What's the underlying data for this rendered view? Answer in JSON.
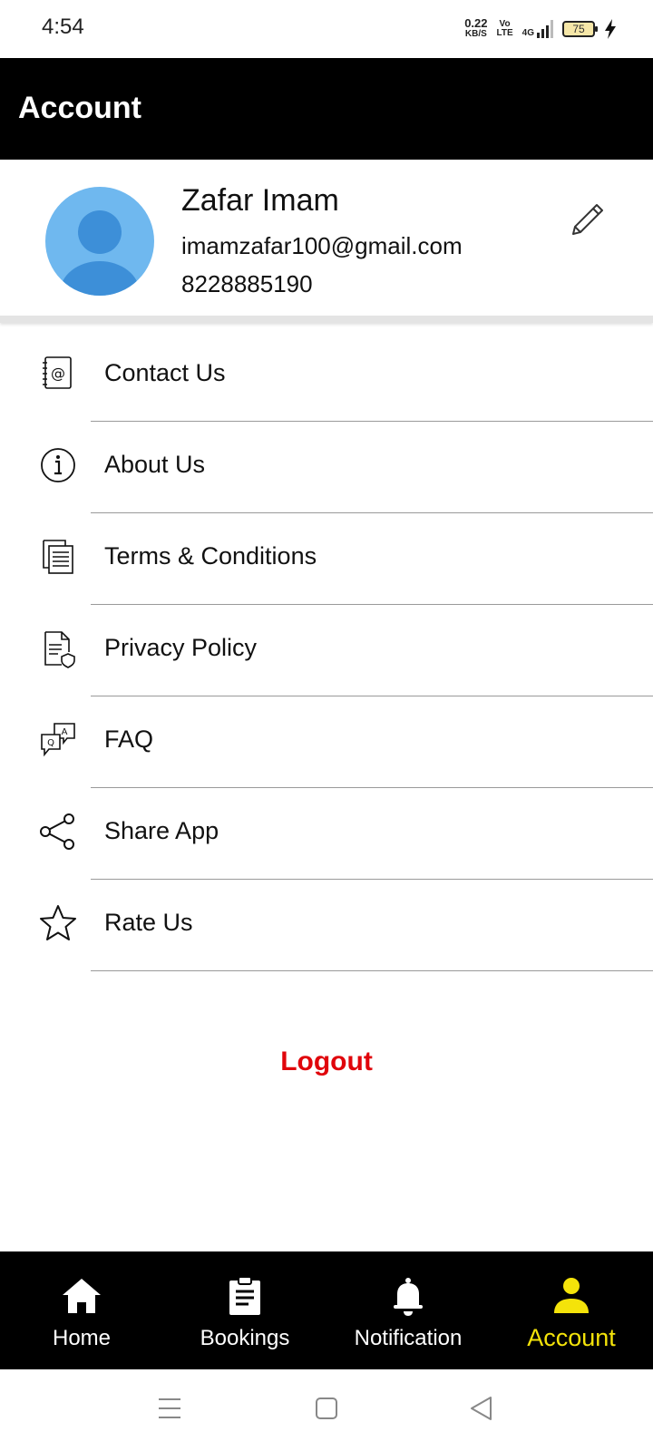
{
  "status_bar": {
    "time": "4:54",
    "net_speed": "0.22",
    "net_unit": "KB/S",
    "volte_top": "Vo",
    "volte_bottom": "LTE",
    "network": "4G",
    "battery": "75"
  },
  "header": {
    "title": "Account"
  },
  "profile": {
    "name": "Zafar Imam",
    "email": "imamzafar100@gmail.com",
    "phone": "8228885190",
    "edit_icon": "pencil-icon"
  },
  "menu": {
    "items": [
      {
        "label": "Contact Us",
        "icon": "contact-book-icon"
      },
      {
        "label": "About Us",
        "icon": "info-icon"
      },
      {
        "label": "Terms & Conditions",
        "icon": "document-list-icon"
      },
      {
        "label": "Privacy Policy",
        "icon": "document-shield-icon"
      },
      {
        "label": "FAQ",
        "icon": "qa-bubbles-icon"
      },
      {
        "label": "Share App",
        "icon": "share-icon"
      },
      {
        "label": "Rate Us",
        "icon": "star-icon"
      }
    ]
  },
  "logout": {
    "label": "Logout",
    "color": "#e0050b"
  },
  "bottom_nav": {
    "items": [
      {
        "label": "Home",
        "icon": "home-icon"
      },
      {
        "label": "Bookings",
        "icon": "clipboard-icon"
      },
      {
        "label": "Notification",
        "icon": "bell-icon"
      },
      {
        "label": "Account",
        "icon": "user-icon"
      }
    ],
    "active": "Account",
    "active_color": "#f4e30a"
  },
  "system_nav": {
    "buttons": [
      "menu-lines-icon",
      "square-icon",
      "back-triangle-icon"
    ]
  }
}
